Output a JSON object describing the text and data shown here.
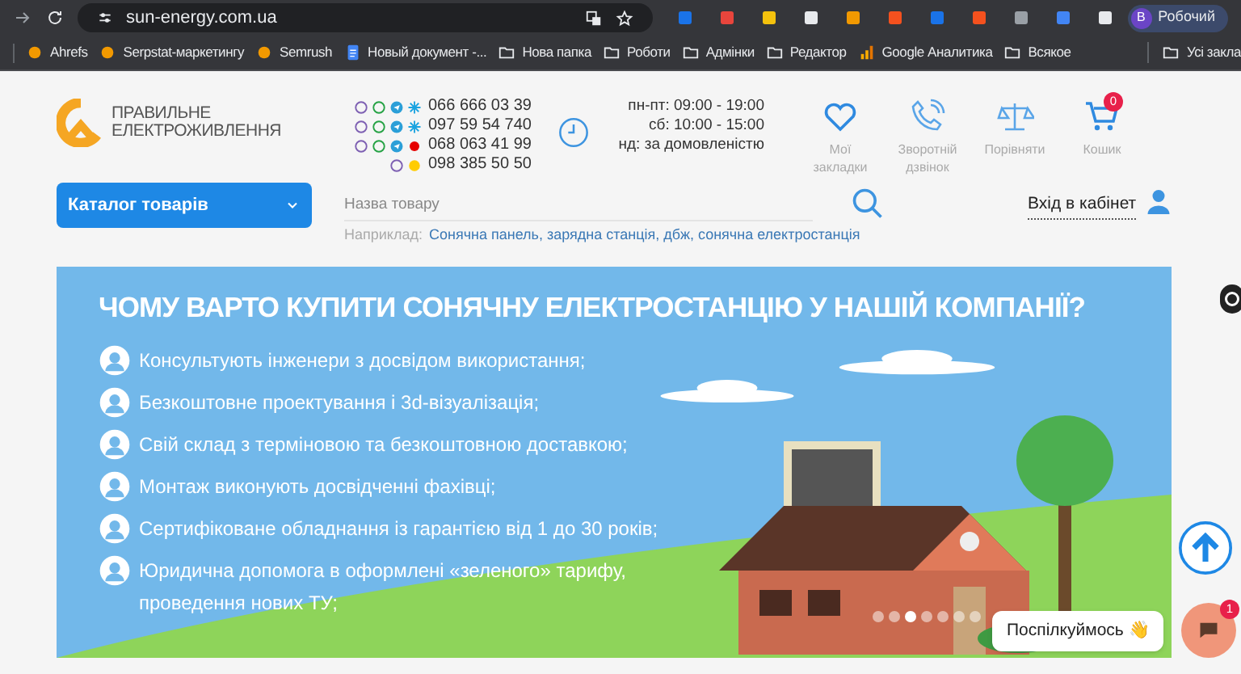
{
  "browser": {
    "url": "sun-energy.com.ua",
    "profile": {
      "initial": "В",
      "label": "Робочий"
    },
    "bookmarks": [
      {
        "label": "Ahrefs",
        "kind": "site"
      },
      {
        "label": "Serpstat-маркетингу",
        "kind": "site"
      },
      {
        "label": "Semrush",
        "kind": "site"
      },
      {
        "label": "Новый документ -...",
        "kind": "doc"
      },
      {
        "label": "Нова папка",
        "kind": "folder"
      },
      {
        "label": "Роботи",
        "kind": "folder"
      },
      {
        "label": "Адмінки",
        "kind": "folder"
      },
      {
        "label": "Редактор",
        "kind": "folder"
      },
      {
        "label": "Google Аналитика",
        "kind": "chart"
      },
      {
        "label": "Всякое",
        "kind": "folder"
      }
    ],
    "all_bookmarks": "Усі закла"
  },
  "header": {
    "logo": {
      "line_1": "ПРАВИЛЬНЕ",
      "line_2": "ЕЛЕКТРОЖИВЛЕННЯ"
    },
    "phones": [
      {
        "number": "066 666 03 39",
        "kind": "star"
      },
      {
        "number": "097 59 54 740",
        "kind": "star"
      },
      {
        "number": "068 063 41 99",
        "kind": "dot"
      },
      {
        "number": "098 385 50 50",
        "kind": "swirl"
      }
    ],
    "hours": [
      "пн-пт: 09:00 - 19:00",
      "сб: 10:00 - 15:00",
      "нд: за домовленістю"
    ],
    "actions": [
      {
        "kind": "heart",
        "label": "Мої закладки"
      },
      {
        "kind": "phone",
        "label": "Зворотній дзвінок"
      },
      {
        "kind": "scales",
        "label": "Порівняти"
      },
      {
        "kind": "cart",
        "label": "Кошик",
        "badge": "0"
      }
    ],
    "catalog_button": "Каталог товарів",
    "search": {
      "placeholder": "Назва товару",
      "example_label": "Наприклад:",
      "examples": "Сонячна панель, зарядна станція, дбж, сонячна електростанція"
    },
    "login": "Вхід в кабінет"
  },
  "banner": {
    "title": "ЧОМУ ВАРТО КУПИТИ СОНЯЧНУ ЕЛЕКТРОСТАНЦІЮ У НАШІЙ КОМПАНІЇ?",
    "points": [
      "Консультують інженери з досвідом використання;",
      "Безкоштовне проектування і 3d-візуалізація;",
      "Свій склад з терміновою та безкоштовною доставкою;",
      "Монтаж виконують досвідченні фахівці;",
      "Сертифіковане обладнання із гарантією від 1 до 30 років;",
      "Юридична допомога в оформлені «зеленого» тарифу, проведення нових ТУ;"
    ],
    "dots": [
      {
        "selected": false
      },
      {
        "selected": false
      },
      {
        "selected": true
      },
      {
        "selected": false
      },
      {
        "selected": false
      },
      {
        "selected": false
      },
      {
        "selected": false
      }
    ]
  },
  "chat": {
    "label": "Поспілкуймось 👋",
    "badge": "1"
  }
}
